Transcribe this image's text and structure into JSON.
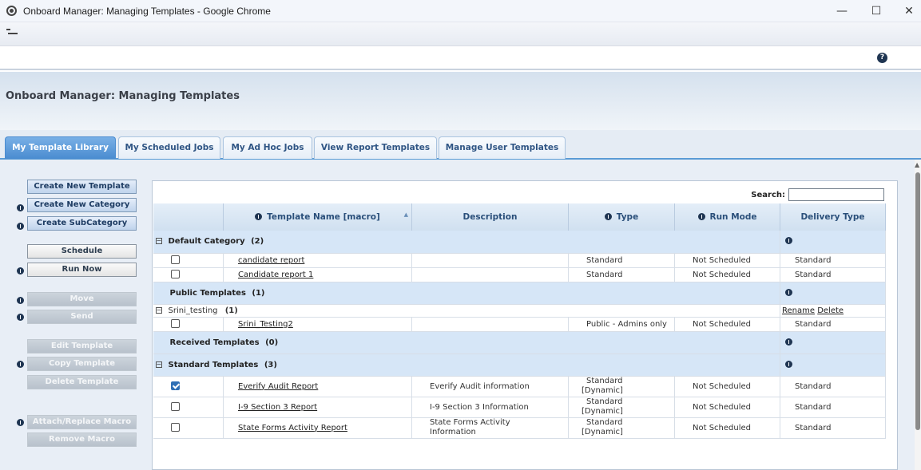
{
  "window": {
    "title": "Onboard Manager: Managing Templates - Google Chrome",
    "minimize": "—",
    "maximize": "☐",
    "close": "✕"
  },
  "page": {
    "heading": "Onboard Manager: Managing Templates",
    "help_icon": "?"
  },
  "tabs": [
    {
      "label": "My Template Library",
      "active": true
    },
    {
      "label": "My Scheduled Jobs",
      "active": false
    },
    {
      "label": "My Ad Hoc Jobs",
      "active": false
    },
    {
      "label": "View Report Templates",
      "active": false
    },
    {
      "label": "Manage User Templates",
      "active": false
    }
  ],
  "actions": {
    "create_new_template": "Create New Template",
    "create_new_category": "Create New Category",
    "create_subcategory": "Create SubCategory",
    "schedule": "Schedule",
    "run_now": "Run Now",
    "move": "Move",
    "send": "Send",
    "edit_template": "Edit Template",
    "copy_template": "Copy Template",
    "delete_template": "Delete Template",
    "attach_replace_macro": "Attach/Replace Macro",
    "remove_macro": "Remove Macro"
  },
  "search": {
    "label": "Search:",
    "value": ""
  },
  "columns": {
    "template_name": "Template Name [macro]",
    "description": "Description",
    "type": "Type",
    "run_mode": "Run Mode",
    "delivery_type": "Delivery Type"
  },
  "categories": {
    "default": {
      "label": "Default Category",
      "count": "(2)",
      "rows": [
        {
          "checked": false,
          "name": "candidate report",
          "description": "",
          "type": "Standard",
          "run_mode": "Not Scheduled",
          "delivery": "Standard"
        },
        {
          "checked": false,
          "name": "Candidate report 1",
          "description": "",
          "type": "Standard",
          "run_mode": "Not Scheduled",
          "delivery": "Standard"
        }
      ]
    },
    "public": {
      "label": "Public Templates",
      "count": "(1)",
      "subcategory": {
        "label": "Srini_testing",
        "count": "(1)",
        "rename": "Rename",
        "delete": "Delete"
      },
      "rows": [
        {
          "checked": false,
          "name": "Srini_Testing2",
          "description": "",
          "type": "Public - Admins only",
          "run_mode": "Not Scheduled",
          "delivery": "Standard"
        }
      ]
    },
    "received": {
      "label": "Received Templates",
      "count": "(0)"
    },
    "standard": {
      "label": "Standard Templates",
      "count": "(3)",
      "rows": [
        {
          "checked": true,
          "name": "Everify Audit Report",
          "description": "Everify Audit information",
          "type_line1": "Standard",
          "type_line2": "[Dynamic]",
          "run_mode": "Not Scheduled",
          "delivery": "Standard"
        },
        {
          "checked": false,
          "name": "I-9 Section 3 Report",
          "description": "I-9 Section 3 Information",
          "type_line1": "Standard",
          "type_line2": "[Dynamic]",
          "run_mode": "Not Scheduled",
          "delivery": "Standard"
        },
        {
          "checked": false,
          "name": "State Forms Activity Report",
          "description_line1": "State Forms Activity",
          "description_line2": "Information",
          "type_line1": "Standard",
          "type_line2": "[Dynamic]",
          "run_mode": "Not Scheduled",
          "delivery": "Standard"
        }
      ]
    }
  },
  "colors": {
    "accent": "#4a8cd0",
    "category_row": "#d6e6f7",
    "header_text": "#2a4f7a"
  }
}
